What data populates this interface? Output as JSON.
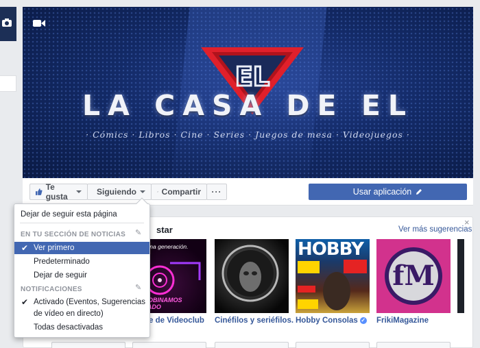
{
  "cover": {
    "title": "LA CASA DE EL",
    "subtitle": "· Cómics · Libros · Cine · Series · Juegos de mesa · Videojuegos ·",
    "logo_letters": "EL"
  },
  "actions": {
    "like_label": "Te gusta",
    "follow_label": "Siguiendo",
    "share_label": "Compartir",
    "more_label": "···",
    "app_label": "Usar aplicación"
  },
  "dropdown": {
    "unfollow_page": "Dejar de seguir esta página",
    "news_header": "EN TU SECCIÓN DE NOTICIAS",
    "news_options": [
      "Ver primero",
      "Predeterminado",
      "Dejar de seguir"
    ],
    "notif_header": "NOTIFICACIONES",
    "notif_options": [
      "Activado (Eventos, Sugerencias de vídeo en directo)",
      "Todas desactivadas"
    ]
  },
  "suggestions": {
    "title_fragment": "star",
    "see_more": "Ver más sugerencias",
    "close": "×",
    "items": [
      {
        "name": "e de Videoclub"
      },
      {
        "name": "Cinéfilos y seriéfilos."
      },
      {
        "name": "Hobby Consolas",
        "verified": true
      },
      {
        "name": "FrikiMagazine"
      }
    ],
    "thumb_text": {
      "videoclub_top": "que una generación.",
      "videoclub_bottom": "REBOBINAMOS PASADO",
      "hobby_mag": "HOBBY",
      "friki_letters": "fM"
    }
  },
  "colors": {
    "accent": "#4267b2",
    "link": "#365899",
    "cover_dark": "#0a1a44",
    "logo_red": "#e0202b"
  }
}
